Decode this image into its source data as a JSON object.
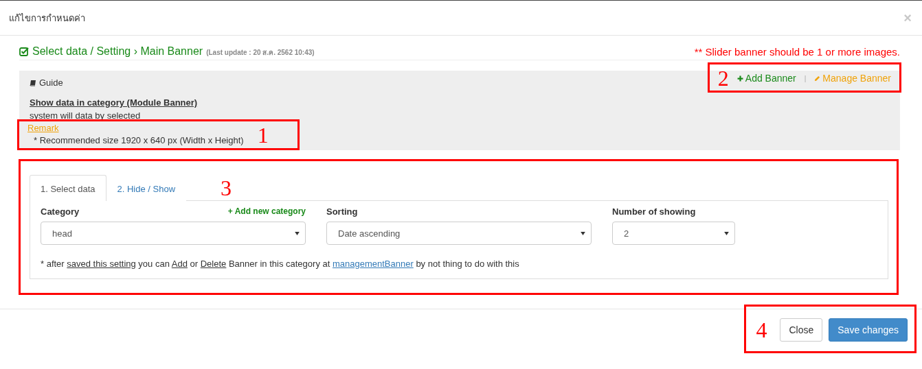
{
  "window": {
    "title": "แก้ไขการกำหนดค่า",
    "close": "×"
  },
  "heading": {
    "title": "Select data / Setting › Main Banner",
    "last_update": "(Last update : 20 ส.ค. 2562 10:43)",
    "warning": "** Slider banner should be 1 or more images."
  },
  "guide": {
    "title": "Guide",
    "subtitle": "Show data in category (Module Banner)",
    "description": "system will data by selected",
    "remark_link": "Remark",
    "remark": "* Recommended size 1920 x 640 px (Width x Height)",
    "actions": [
      {
        "kind": "add",
        "label": "Add Banner"
      },
      {
        "kind": "manage",
        "label": "Manage Banner"
      }
    ],
    "separator": "|"
  },
  "tabs": [
    {
      "label": "1. Select data",
      "selected": true
    },
    {
      "label": "2. Hide / Show",
      "selected": false
    }
  ],
  "fields": [
    {
      "label": "Category",
      "action": "+ Add new category",
      "value": "head"
    },
    {
      "label": "Sorting",
      "value": "Date ascending"
    },
    {
      "label": "Number of showing",
      "value": "2"
    }
  ],
  "note": [
    {
      "kind": "text",
      "text": "* after "
    },
    {
      "kind": "underline",
      "text": "saved this setting"
    },
    {
      "kind": "text",
      "text": " you can "
    },
    {
      "kind": "underline",
      "text": "Add"
    },
    {
      "kind": "text",
      "text": " or "
    },
    {
      "kind": "underline",
      "text": "Delete"
    },
    {
      "kind": "text",
      "text": " Banner in this category at "
    },
    {
      "kind": "link",
      "text": "managementBanner"
    },
    {
      "kind": "text",
      "text": " by not thing to do with this"
    }
  ],
  "buttons": [
    {
      "kind": "default",
      "label": "Close"
    },
    {
      "kind": "primary",
      "label": "Save changes"
    }
  ],
  "callouts": [
    "1",
    "2",
    "3",
    "4"
  ]
}
